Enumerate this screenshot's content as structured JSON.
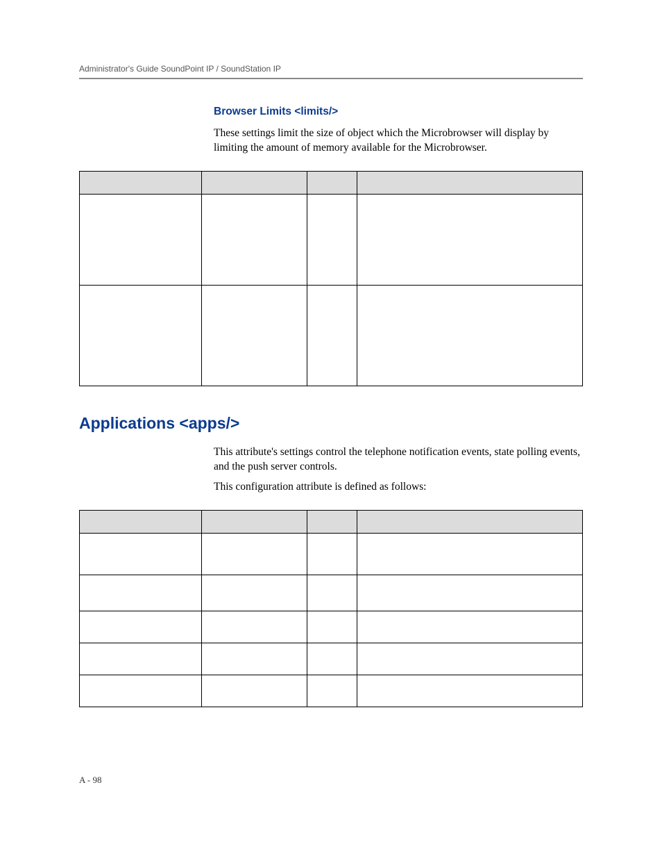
{
  "header": {
    "running_head": "Administrator's Guide SoundPoint IP / SoundStation IP"
  },
  "section1": {
    "title": "Browser Limits <limits/>",
    "paragraph": "These settings limit the size of object which the Microbrowser will display by limiting the amount of memory available for the Microbrowser."
  },
  "section2": {
    "title": "Applications <apps/>",
    "paragraph1": "This attribute's settings control the telephone notification events, state polling events, and the push server controls.",
    "paragraph2": "This configuration attribute is defined as follows:"
  },
  "footer": {
    "page_label": "A - 98"
  }
}
